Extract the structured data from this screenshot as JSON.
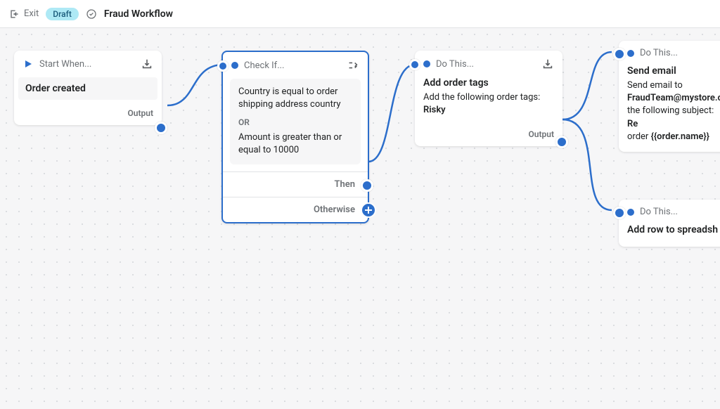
{
  "topbar": {
    "exit": "Exit",
    "badge": "Draft",
    "title": "Fraud Workflow"
  },
  "nodes": {
    "trigger": {
      "header": "Start When...",
      "event": "Order created",
      "output_label": "Output"
    },
    "condition": {
      "header": "Check If...",
      "rule1": "Country is equal to order shipping address country",
      "or": "OR",
      "rule2": "Amount is greater than or equal to 10000",
      "then": "Then",
      "otherwise": "Otherwise"
    },
    "action1": {
      "header": "Do This...",
      "title": "Add order tags",
      "desc_prefix": "Add the following order tags: ",
      "desc_bold": "Risky",
      "output_label": "Output"
    },
    "action2": {
      "header": "Do This...",
      "title": "Send email",
      "desc_prefix": "Send email to ",
      "desc_email": "FraudTeam@mystore.c",
      "desc_mid": " the following subject: ",
      "desc_bold": "Re",
      "desc_line2_prefix": "order ",
      "desc_line2_bold": "{{order.name}}"
    },
    "action3": {
      "header": "Do This...",
      "title": "Add row to spreadsh"
    }
  }
}
